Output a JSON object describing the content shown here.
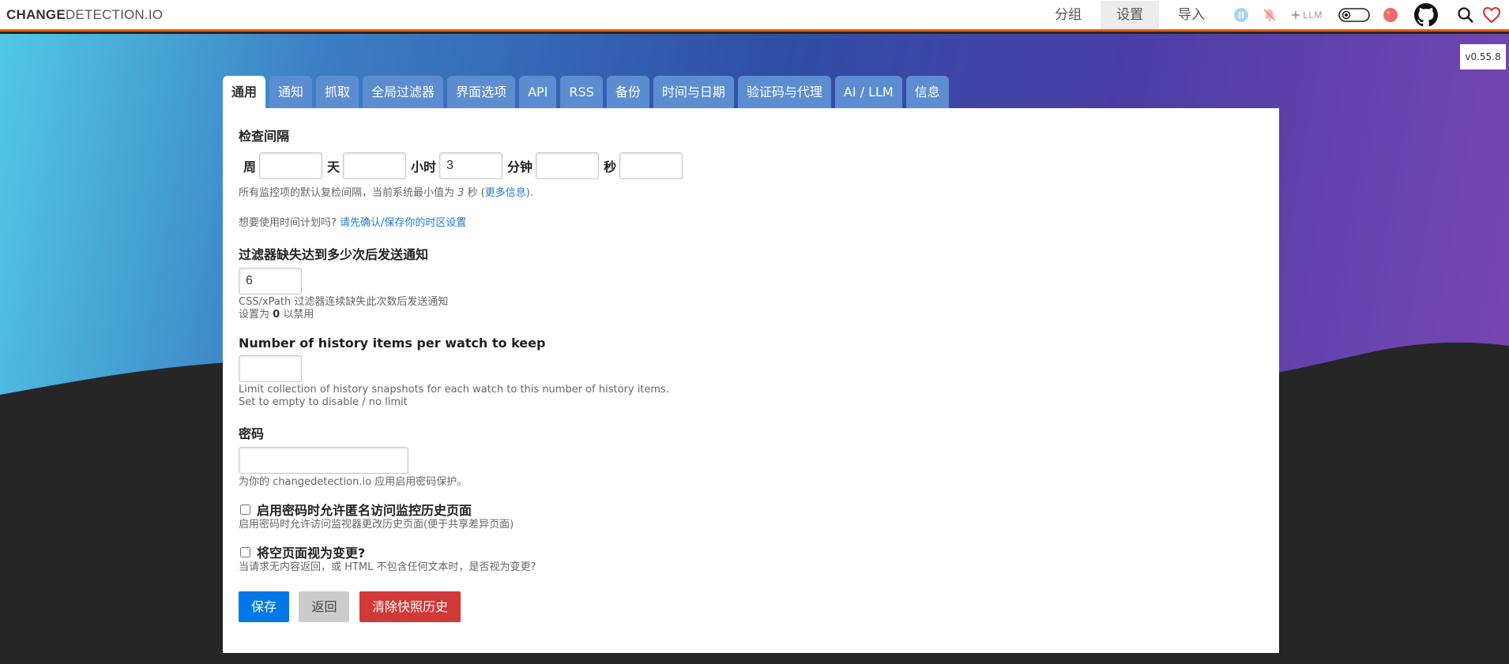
{
  "header": {
    "brand_bold": "CHANGE",
    "brand_rest": "DETECTION.IO",
    "nav": [
      {
        "label": "分组"
      },
      {
        "label": "设置"
      },
      {
        "label": "导入"
      }
    ],
    "llm_label": "LLM",
    "icons": [
      "pause-icon",
      "mute-bell-icon",
      "llm-sparkle-icon",
      "dark-mode-toggle-icon",
      "language-flag-icon",
      "github-icon",
      "search-icon",
      "heart-icon"
    ]
  },
  "version": "v0.55.8",
  "tabs": [
    "通用",
    "通知",
    "抓取",
    "全局过滤器",
    "界面选项",
    "API",
    "RSS",
    "备份",
    "时间与日期",
    "验证码与代理",
    "AI / LLM",
    "信息"
  ],
  "check_interval": {
    "title": "检查间隔",
    "units": [
      "周",
      "天",
      "小时",
      "分钟",
      "秒"
    ],
    "values": [
      "",
      "",
      "3",
      "",
      ""
    ],
    "help_prefix": "所有监控项的默认复检间隔，当前系统最小值为 ",
    "help_min": "3",
    "help_unit": " 秒 (",
    "help_link": "更多信息",
    "help_suffix": ").",
    "schedule_text": "想要使用时间计划吗? ",
    "schedule_link": "请先确认/保存你的时区设置"
  },
  "filter_failure": {
    "title": "过滤器缺失达到多少次后发送通知",
    "value": "6",
    "help_line1": "CSS/xPath 过滤器连续缺失此次数后发送通知",
    "help_line2_prefix": "设置为 ",
    "help_line2_bold": "0",
    "help_line2_suffix": " 以禁用"
  },
  "history": {
    "title": "Number of history items per watch to keep",
    "value": "",
    "help_line1": "Limit collection of history snapshots for each watch to this number of history items.",
    "help_line2": "Set to empty to disable / no limit"
  },
  "password": {
    "title": "密码",
    "value": "",
    "help": "为你的 changedetection.io 应用启用密码保护。"
  },
  "anon_access": {
    "label": "启用密码时允许匿名访问监控历史页面",
    "help": "启用密码时允许访问监视器更改历史页面(便于共享差异页面)",
    "checked": false
  },
  "empty_page": {
    "label": "将空页面视为变更?",
    "help": "当请求无内容返回，或 HTML 不包含任何文本时，是否视为变更?",
    "checked": false
  },
  "buttons": {
    "save": "保存",
    "back": "返回",
    "clear": "清除快照历史"
  },
  "colors": {
    "accent_orange": "#ed5900",
    "save_button": "#0078e7",
    "back_button": "#cccccc",
    "clear_button": "#d13838",
    "tab_bg": "#5b8dd0"
  }
}
